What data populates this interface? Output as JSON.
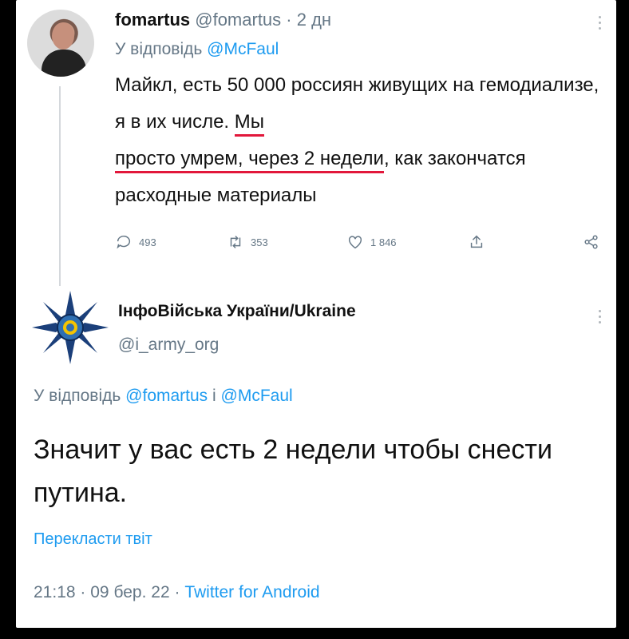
{
  "tweet1": {
    "display_name": "fomartus",
    "handle": "@fomartus",
    "separator": "·",
    "time": "2 дн",
    "reply_prefix": "У відповідь",
    "reply_to": "@McFaul",
    "text_before": "Майкл, есть 50 000 россиян живущих на гемодиализе, я в их числе. ",
    "text_highlighted_1": "Мы",
    "text_highlighted_2": "просто умрем, через 2 недели",
    "text_after": ", как закончатся расходные материалы",
    "replies": "493",
    "retweets": "353",
    "likes": "1 846"
  },
  "tweet2": {
    "display_name": "ІнфоВійська України/Ukraine",
    "handle": "@i_army_org",
    "reply_prefix": "У відповідь",
    "reply_to_1": "@fomartus",
    "reply_joiner": "і",
    "reply_to_2": "@McFaul",
    "text": "Значит у вас есть 2 недели чтобы снести путина.",
    "translate_label": "Перекласти твіт",
    "time": "21:18",
    "sep": "·",
    "date": "09 бер. 22",
    "sep2": "·",
    "source": "Twitter for Android"
  },
  "icons": {
    "reply": "reply-icon",
    "retweet": "retweet-icon",
    "like": "heart-icon",
    "share": "share-icon",
    "network": "network-share-icon",
    "more": "more-vertical-icon"
  },
  "colors": {
    "link": "#1d9bf0",
    "secondary": "#657786",
    "underline": "#e2173b"
  }
}
